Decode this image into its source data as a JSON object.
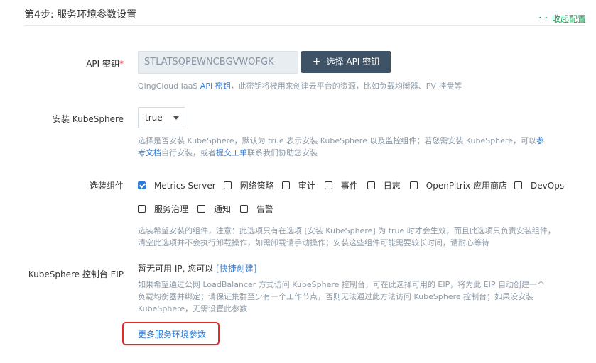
{
  "header": {
    "title": "第4步: 服务环境参数设置",
    "collapse_label": "收起配置"
  },
  "api_key": {
    "label": "API 密钥",
    "required_mark": "*",
    "value": "STLATSQPEWNCBGVWOFGK",
    "select_button_label": "选择 API 密钥",
    "help_prefix": "QingCloud IaaS ",
    "help_link": "API 密钥",
    "help_suffix": "，此密钥将被用来创建云平台的资源，比如负载均衡器、PV 挂盘等"
  },
  "install_kubesphere": {
    "label": "安装 KubeSphere",
    "selected": "true",
    "help_part1": "选择是否安装 KubeSphere，默认为 true 表示安装 KubeSphere 以及监控组件；若您需安装 KubeSphere，可以",
    "help_link1a": "参",
    "help_link1b": "考文档",
    "help_part2": "自行安装，或者",
    "help_link2": "提交工单",
    "help_part3": "联系我们协助您安装"
  },
  "components": {
    "label": "选装组件",
    "options": [
      {
        "label": "Metrics Server",
        "checked": true
      },
      {
        "label": "网络策略",
        "checked": false
      },
      {
        "label": "审计",
        "checked": false
      },
      {
        "label": "事件",
        "checked": false
      },
      {
        "label": "日志",
        "checked": false
      },
      {
        "label": "OpenPitrix 应用商店",
        "checked": false
      },
      {
        "label": "DevOps",
        "checked": false
      },
      {
        "label": "服务治理",
        "checked": false
      },
      {
        "label": "通知",
        "checked": false
      },
      {
        "label": "告警",
        "checked": false
      }
    ],
    "help_line1": "选装希望安装的组件，注意：此选项只有在选项 [安装 KubeSphere] 为 true 时才会生效，而且此选项只负责安装组件，",
    "help_line2": "清空此选项并不会执行卸载操作，如需卸载请手动操作；安装这些组件可能需要较长时间，请耐心等待"
  },
  "eip": {
    "label": "KubeSphere 控制台 EIP",
    "status_text": "暂无可用 IP, 您可以 ",
    "create_link": "[快捷创建]",
    "help_line1": "如果希望通过公网 LoadBalancer 方式访问 KubeSphere 控制台，可在此选择可用的 EIP，将为此 EIP 自动创建一个",
    "help_line2": "负载均衡器并绑定；请保证集群至少有一个工作节点，否则无法通过此方法访问 KubeSphere 控制台；如果没安装",
    "help_line3": "KubeSphere，无需设置此参数"
  },
  "more_params_link": "更多服务环境参数",
  "colors": {
    "accent_green": "#1d9b58",
    "link_blue": "#2d7bd4",
    "button_dark": "#3f5366",
    "highlight_red": "#e02a2a"
  }
}
